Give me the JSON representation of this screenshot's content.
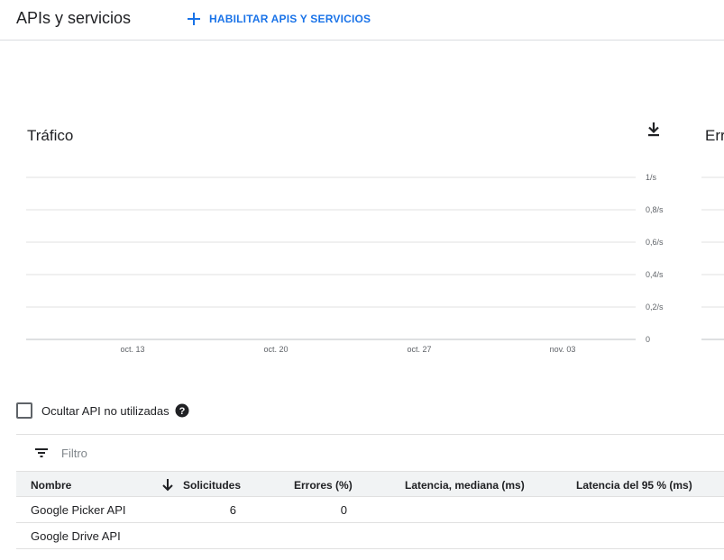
{
  "header": {
    "title": "APIs y servicios",
    "enable_label": "HABILITAR APIS Y SERVICIOS"
  },
  "colors": {
    "accent": "#1a73e8",
    "grid": "#e0e0e0",
    "axis_text": "#5f6368"
  },
  "traffic_card": {
    "title": "Tráfico",
    "download_icon": "download-icon"
  },
  "errors_card": {
    "title": "Errores"
  },
  "chart_data": {
    "type": "line",
    "title": "Tráfico",
    "x_tick_labels": [
      "oct. 13",
      "oct. 20",
      "oct. 27",
      "nov. 03"
    ],
    "y_tick_labels": [
      "1/s",
      "0,8/s",
      "0,6/s",
      "0,4/s",
      "0,2/s",
      "0"
    ],
    "ylim": [
      0,
      1
    ],
    "grid": true,
    "series": []
  },
  "hide_unused": {
    "label": "Ocultar API no utilizadas",
    "checked": false
  },
  "filter": {
    "placeholder": "Filtro"
  },
  "table": {
    "columns": [
      "Nombre",
      "Solicitudes",
      "Errores (%)",
      "Latencia, mediana (ms)",
      "Latencia del 95 % (ms)"
    ],
    "sort_column": "Solicitudes",
    "rows": [
      {
        "name": "Google Picker API",
        "requests": "6",
        "errors": "0",
        "latency_median": "",
        "latency_95": ""
      },
      {
        "name": "Google Drive API",
        "requests": "",
        "errors": "",
        "latency_median": "",
        "latency_95": ""
      }
    ]
  }
}
